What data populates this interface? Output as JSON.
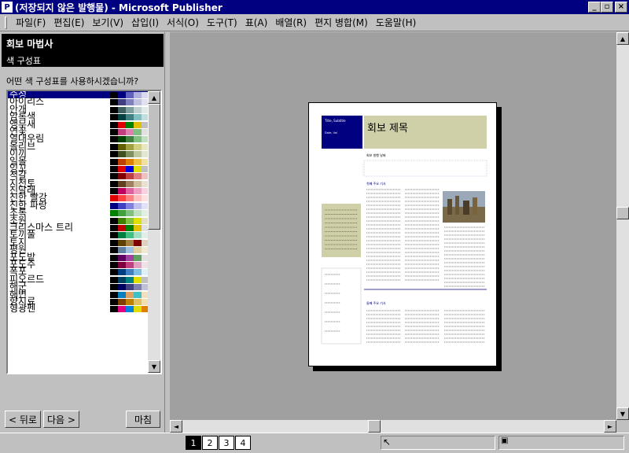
{
  "window": {
    "title": "(저장되지 않은 발행물) - Microsoft Publisher",
    "minimize": "_",
    "restore": "▫",
    "close": "×"
  },
  "menu": [
    "파일(F)",
    "편집(E)",
    "보기(V)",
    "삽입(I)",
    "서식(O)",
    "도구(T)",
    "표(A)",
    "배열(R)",
    "편지 병합(M)",
    "도움말(H)"
  ],
  "wizard": {
    "title": "회보 마법사",
    "subtitle": "색 구성표",
    "question": "어떤 색 구성표를 사용하시겠습니까?",
    "back_label": "< 뒤로",
    "next_label": "다음 >",
    "finish_label": "마침"
  },
  "schemes": [
    {
      "name": "수성",
      "selected": true,
      "colors": [
        "#000000",
        "#000080",
        "#6060c0",
        "#b0b0e0",
        "#d8d8f0"
      ]
    },
    {
      "name": "아이리스",
      "colors": [
        "#000000",
        "#404080",
        "#8080c0",
        "#c0c0e0",
        "#e0e0f0"
      ]
    },
    {
      "name": "안개",
      "colors": [
        "#000000",
        "#406060",
        "#80a0a0",
        "#c0d0d0",
        "#e0e8e8"
      ]
    },
    {
      "name": "암록색",
      "colors": [
        "#000000",
        "#004040",
        "#408080",
        "#80c0c0",
        "#c0e0e0"
      ]
    },
    {
      "name": "앵무새",
      "colors": [
        "#000000",
        "#e00000",
        "#008000",
        "#e0c000",
        "#c0c0c0"
      ]
    },
    {
      "name": "연꽃",
      "colors": [
        "#000000",
        "#c04080",
        "#e080b0",
        "#80c080",
        "#e0e0e0"
      ]
    },
    {
      "name": "열대우림",
      "colors": [
        "#000000",
        "#004000",
        "#408040",
        "#80c080",
        "#c0e0c0"
      ]
    },
    {
      "name": "올리브",
      "colors": [
        "#000000",
        "#606000",
        "#a0a040",
        "#d0d080",
        "#e8e8c0"
      ]
    },
    {
      "name": "이끼",
      "colors": [
        "#000000",
        "#405020",
        "#809060",
        "#c0c8a0",
        "#e0e8d0"
      ]
    },
    {
      "name": "일몰",
      "colors": [
        "#000000",
        "#c04000",
        "#e08000",
        "#f0c040",
        "#f0e0a0"
      ]
    },
    {
      "name": "잉꼬",
      "colors": [
        "#000000",
        "#e00000",
        "#0000e0",
        "#e0e000",
        "#c0c0c0"
      ]
    },
    {
      "name": "적갈",
      "colors": [
        "#000000",
        "#800000",
        "#c04040",
        "#e08080",
        "#f0c0c0"
      ]
    },
    {
      "name": "지천토",
      "colors": [
        "#000000",
        "#604020",
        "#a08060",
        "#d0c0a0",
        "#e8e0d0"
      ]
    },
    {
      "name": "진달래",
      "colors": [
        "#000000",
        "#c00060",
        "#e060a0",
        "#f0a0c0",
        "#f8d0e0"
      ]
    },
    {
      "name": "진한 빨강",
      "colors": [
        "#e00000",
        "#ff4040",
        "#ff8080",
        "#ffc0c0",
        "#ffe0e0"
      ]
    },
    {
      "name": "진한 파랑",
      "colors": [
        "#000080",
        "#4040c0",
        "#8080e0",
        "#c0c0f0",
        "#e0e0f8"
      ]
    },
    {
      "name": "초록",
      "colors": [
        "#008000",
        "#40a040",
        "#80c080",
        "#c0e0c0",
        "#e0f0e0"
      ]
    },
    {
      "name": "초원",
      "colors": [
        "#000000",
        "#408000",
        "#80c040",
        "#e0e000",
        "#e0e0c0"
      ]
    },
    {
      "name": "크리스마스 트리",
      "colors": [
        "#000000",
        "#c00000",
        "#008000",
        "#e0c000",
        "#e0e0e0"
      ]
    },
    {
      "name": "토끼풀",
      "colors": [
        "#000000",
        "#008040",
        "#40c080",
        "#a0e0c0",
        "#e0f0e8"
      ]
    },
    {
      "name": "토지",
      "colors": [
        "#000000",
        "#604000",
        "#a08040",
        "#800000",
        "#e0d0c0"
      ]
    },
    {
      "name": "평원",
      "colors": [
        "#000000",
        "#6080a0",
        "#a0c0e0",
        "#e0d0a0",
        "#f0e8d0"
      ]
    },
    {
      "name": "포도밭",
      "colors": [
        "#000000",
        "#600060",
        "#a040a0",
        "#60a060",
        "#e0e0e0"
      ]
    },
    {
      "name": "포도주",
      "colors": [
        "#000000",
        "#800040",
        "#c04080",
        "#e0a0c0",
        "#f0e0e8"
      ]
    },
    {
      "name": "폭포",
      "colors": [
        "#000000",
        "#004080",
        "#4080c0",
        "#80c0e0",
        "#e0f0f8"
      ]
    },
    {
      "name": "피오르드",
      "colors": [
        "#000000",
        "#004060",
        "#008080",
        "#e0e000",
        "#c0c0c0"
      ]
    },
    {
      "name": "해군",
      "colors": [
        "#000000",
        "#000060",
        "#404080",
        "#8080b0",
        "#c0c0d8"
      ]
    },
    {
      "name": "해변",
      "colors": [
        "#000000",
        "#0080c0",
        "#e0a060",
        "#40c0c0",
        "#f0e0c0"
      ]
    },
    {
      "name": "향지료",
      "colors": [
        "#000000",
        "#804000",
        "#c08000",
        "#e0c060",
        "#f0e0b0"
      ]
    },
    {
      "name": "형광펜",
      "colors": [
        "#000000",
        "#e00080",
        "#0080e0",
        "#e0e000",
        "#e08000"
      ]
    }
  ],
  "newsletter": {
    "headline": "회보 제목",
    "banner_line1": "Title, Subtitle",
    "banner_line2": "Date, Vol",
    "subhead": "회보 발행 날짜",
    "story1": "첫째 주요 기사",
    "story2": "둘째 주요 기사"
  },
  "pages": [
    "1",
    "2",
    "3",
    "4"
  ],
  "colors": {
    "titlebar": "#000080",
    "selected": "#000080",
    "banner_box": "#000080",
    "headline_fill": "#d0d0a8"
  }
}
